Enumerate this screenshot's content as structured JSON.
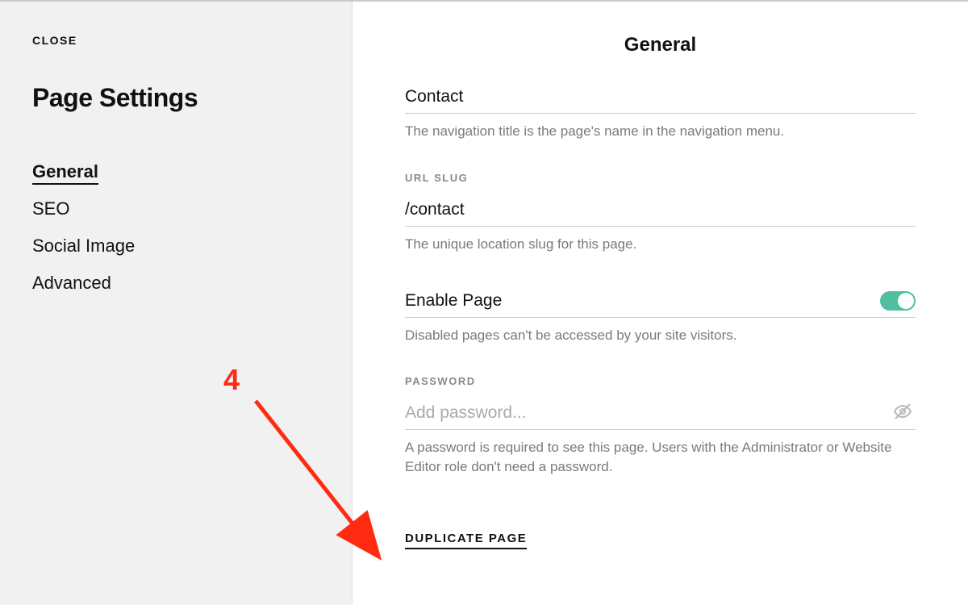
{
  "sidebar": {
    "close_label": "CLOSE",
    "page_title": "Page Settings",
    "nav_items": [
      {
        "label": "General",
        "active": true
      },
      {
        "label": "SEO",
        "active": false
      },
      {
        "label": "Social Image",
        "active": false
      },
      {
        "label": "Advanced",
        "active": false
      }
    ]
  },
  "main": {
    "header": "General",
    "nav_title_value": "Contact",
    "nav_title_help": "The navigation title is the page's name in the navigation menu.",
    "url_slug_label": "URL SLUG",
    "url_slug_value": "/contact",
    "url_slug_help": "The unique location slug for this page.",
    "enable_label": "Enable Page",
    "enable_help": "Disabled pages can't be accessed by your site visitors.",
    "password_label": "PASSWORD",
    "password_placeholder": "Add password...",
    "password_help": "A password is required to see this page. Users with the Administrator or Website Editor role don't need a password.",
    "duplicate_label": "DUPLICATE PAGE"
  },
  "annotation": {
    "number": "4"
  },
  "colors": {
    "toggle_on": "#4fbf9f",
    "annotation": "#ff2a12"
  }
}
